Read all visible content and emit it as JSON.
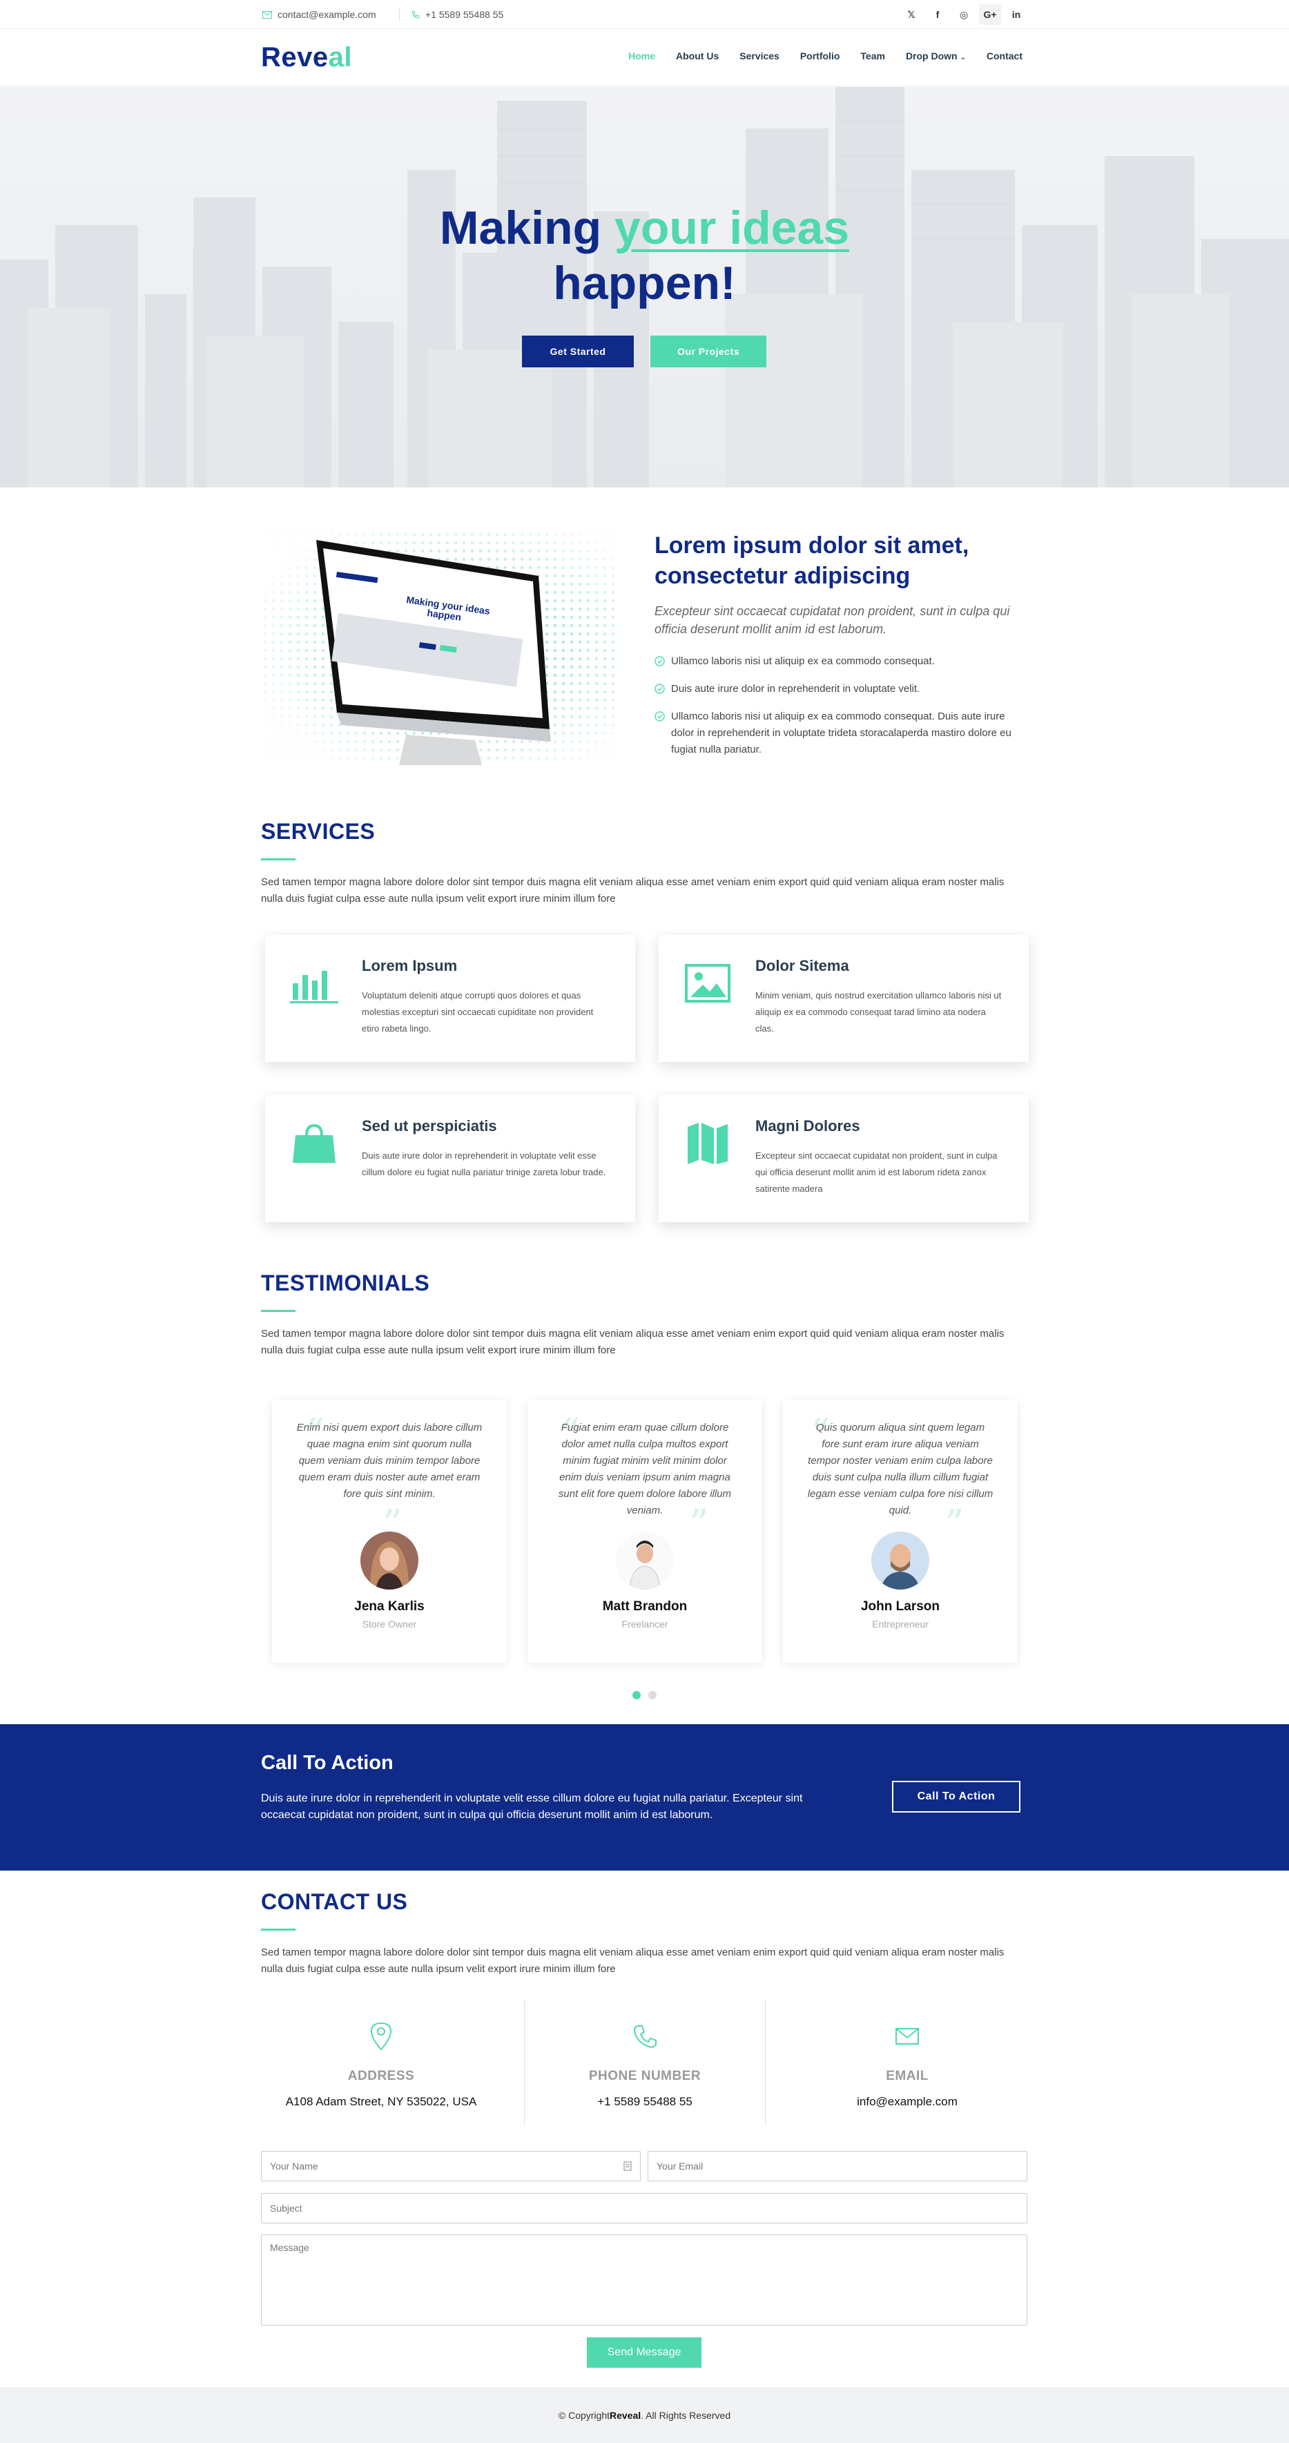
{
  "topbar": {
    "email": "contact@example.com",
    "phone": "+1 5589 55488 55",
    "social": [
      "𝕏",
      "f",
      "◎",
      "G+",
      "in"
    ]
  },
  "header": {
    "logo_part1": "Reve",
    "logo_part2": "al",
    "nav": [
      "Home",
      "About Us",
      "Services",
      "Portfolio",
      "Team",
      "Drop Down",
      "Contact"
    ]
  },
  "hero": {
    "title_part1": "Making ",
    "title_highlight": "your ideas",
    "title_part2": "happen!",
    "btn_get_started": "Get Started",
    "btn_projects": "Our Projects"
  },
  "about": {
    "title": "Lorem ipsum dolor sit amet, consectetur adipiscing",
    "lead": "Excepteur sint occaecat cupidatat non proident, sunt in culpa qui officia deserunt mollit anim id est laborum.",
    "items": [
      "Ullamco laboris nisi ut aliquip ex ea commodo consequat.",
      "Duis aute irure dolor in reprehenderit in voluptate velit.",
      "Ullamco laboris nisi ut aliquip ex ea commodo consequat. Duis aute irure dolor in reprehenderit in voluptate trideta storacalaperda mastiro dolore eu fugiat nulla pariatur."
    ]
  },
  "services": {
    "title": "SERVICES",
    "desc": "Sed tamen tempor magna labore dolore dolor sint tempor duis magna elit veniam aliqua esse amet veniam enim export quid quid veniam aliqua eram noster malis nulla duis fugiat culpa esse aute nulla ipsum velit export irure minim illum fore",
    "items": [
      {
        "title": "Lorem Ipsum",
        "text": "Voluptatum deleniti atque corrupti quos dolores et quas molestias excepturi sint occaecati cupiditate non provident etiro rabeta lingo.",
        "icon": "bar-chart-icon"
      },
      {
        "title": "Dolor Sitema",
        "text": "Minim veniam, quis nostrud exercitation ullamco laboris nisi ut aliquip ex ea commodo consequat tarad limino ata nodera clas.",
        "icon": "picture-icon"
      },
      {
        "title": "Sed ut perspiciatis",
        "text": "Duis aute irure dolor in reprehenderit in voluptate velit esse cillum dolore eu fugiat nulla pariatur trinige zareta lobur trade.",
        "icon": "shopping-bag-icon"
      },
      {
        "title": "Magni Dolores",
        "text": "Excepteur sint occaecat cupidatat non proident, sunt in culpa qui officia deserunt mollit anim id est laborum rideta zanox satirente madera",
        "icon": "map-icon"
      }
    ]
  },
  "testimonials": {
    "title": "TESTIMONIALS",
    "desc": "Sed tamen tempor magna labore dolore dolor sint tempor duis magna elit veniam aliqua esse amet veniam enim export quid quid veniam aliqua eram noster malis nulla duis fugiat culpa esse aute nulla ipsum velit export irure minim illum fore",
    "items": [
      {
        "quote": "Enim nisi quem export duis labore cillum quae magna enim sint quorum nulla quem veniam duis minim tempor labore quem eram duis noster aute amet eram fore quis sint minim.",
        "name": "Jena Karlis",
        "role": "Store Owner"
      },
      {
        "quote": "Fugiat enim eram quae cillum dolore dolor amet nulla culpa multos export minim fugiat minim velit minim dolor enim duis veniam ipsum anim magna sunt elit fore quem dolore labore illum veniam.",
        "name": "Matt Brandon",
        "role": "Freelancer"
      },
      {
        "quote": "Quis quorum aliqua sint quem legam fore sunt eram irure aliqua veniam tempor noster veniam enim culpa labore duis sunt culpa nulla illum cillum fugiat legam esse veniam culpa fore nisi cillum quid.",
        "name": "John Larson",
        "role": "Entrepreneur"
      }
    ]
  },
  "cta": {
    "title": "Call To Action",
    "text": "Duis aute irure dolor in reprehenderit in voluptate velit esse cillum dolore eu fugiat nulla pariatur. Excepteur sint occaecat cupidatat non proident, sunt in culpa qui officia deserunt mollit anim id est laborum.",
    "button": "Call To Action"
  },
  "contact": {
    "title": "CONTACT US",
    "desc": "Sed tamen tempor magna labore dolore dolor sint tempor duis magna elit veniam aliqua esse amet veniam enim export quid quid veniam aliqua eram noster malis nulla duis fugiat culpa esse aute nulla ipsum velit export irure minim illum fore",
    "address_label": "ADDRESS",
    "address": "A108 Adam Street, NY 535022, USA",
    "phone_label": "PHONE NUMBER",
    "phone": "+1 5589 55488 55",
    "email_label": "EMAIL",
    "email": "info@example.com",
    "form": {
      "name_placeholder": "Your Name",
      "email_placeholder": "Your Email",
      "subject_placeholder": "Subject",
      "message_placeholder": "Message",
      "send": "Send Message"
    }
  },
  "footer": {
    "prefix": "© Copyright ",
    "brand": "Reveal",
    "suffix": ". All Rights Reserved"
  },
  "colors": {
    "navy": "#0f2a87",
    "accent": "#50d8af"
  }
}
